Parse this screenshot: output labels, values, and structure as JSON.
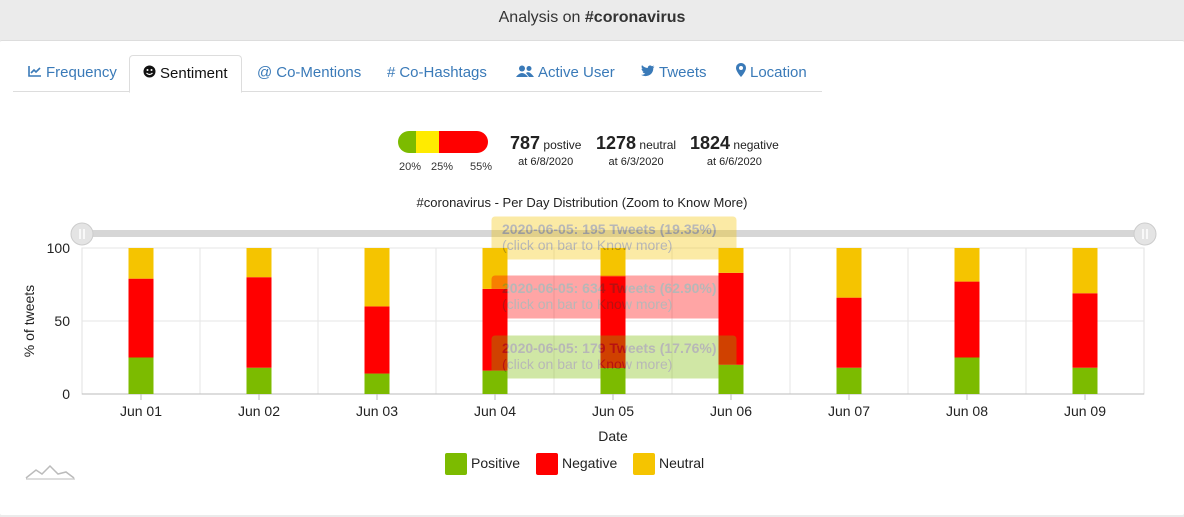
{
  "header": {
    "prefix": "Analysis on ",
    "hashtag": "#coronavirus"
  },
  "tabs": [
    {
      "label": "Frequency",
      "icon": "line-chart-icon",
      "glyph": "📈"
    },
    {
      "label": "Sentiment",
      "icon": "smile-icon",
      "glyph": "☻"
    },
    {
      "label": "Co-Mentions",
      "icon": "at-icon",
      "glyph": "@"
    },
    {
      "label": "Co-Hashtags",
      "icon": "hash-icon",
      "glyph": "#"
    },
    {
      "label": "Active User",
      "icon": "users-icon",
      "glyph": "👥"
    },
    {
      "label": "Tweets",
      "icon": "twitter-icon",
      "glyph": "🐦"
    },
    {
      "label": "Location",
      "icon": "map-marker-icon",
      "glyph": "📍"
    }
  ],
  "summary": {
    "bar": [
      {
        "pct": 20,
        "label": "20%",
        "color": "#7cbb00"
      },
      {
        "pct": 25,
        "label": "25%",
        "color": "#ffeb00"
      },
      {
        "pct": 55,
        "label": "55%",
        "color": "#ff0000"
      }
    ],
    "positive": {
      "count": "787",
      "word": "postive",
      "date": "at 6/8/2020"
    },
    "neutral": {
      "count": "1278",
      "word": "neutral",
      "date": "at 6/3/2020"
    },
    "negative": {
      "count": "1824",
      "word": "negative",
      "date": "at 6/6/2020"
    }
  },
  "tooltips": [
    {
      "title": "2020-06-05: 195 Tweets (19.35%)",
      "hint": "(click on bar to Know more)",
      "color": "#f5c400"
    },
    {
      "title": "2020-06-05: 634 Tweets (62.90%)",
      "hint": "(click on bar to Know more)",
      "color": "#ff0000"
    },
    {
      "title": "2020-06-05: 179 Tweets (17.76%)",
      "hint": "(click on bar to Know more)",
      "color": "#7cbb00"
    }
  ],
  "chart_data": {
    "type": "bar",
    "stacked": true,
    "title": "#coronavirus - Per Day Distribution (Zoom to Know More)",
    "xlabel": "Date",
    "ylabel": "% of tweets",
    "ylim": [
      0,
      100
    ],
    "yticks": [
      0,
      50,
      100
    ],
    "grid": true,
    "legend_position": "bottom",
    "categories": [
      "Jun 01",
      "Jun 02",
      "Jun 03",
      "Jun 04",
      "Jun 05",
      "Jun 06",
      "Jun 07",
      "Jun 08",
      "Jun 09"
    ],
    "series": [
      {
        "name": "Positive",
        "color": "#7cbb00",
        "values": [
          25,
          18,
          14,
          16,
          17.76,
          20,
          18,
          25,
          18
        ]
      },
      {
        "name": "Negative",
        "color": "#ff0000",
        "values": [
          54,
          62,
          46,
          56,
          62.9,
          63,
          48,
          52,
          51
        ]
      },
      {
        "name": "Neutral",
        "color": "#f5c400",
        "values": [
          21,
          20,
          40,
          28,
          19.35,
          17,
          34,
          23,
          31
        ]
      }
    ]
  }
}
